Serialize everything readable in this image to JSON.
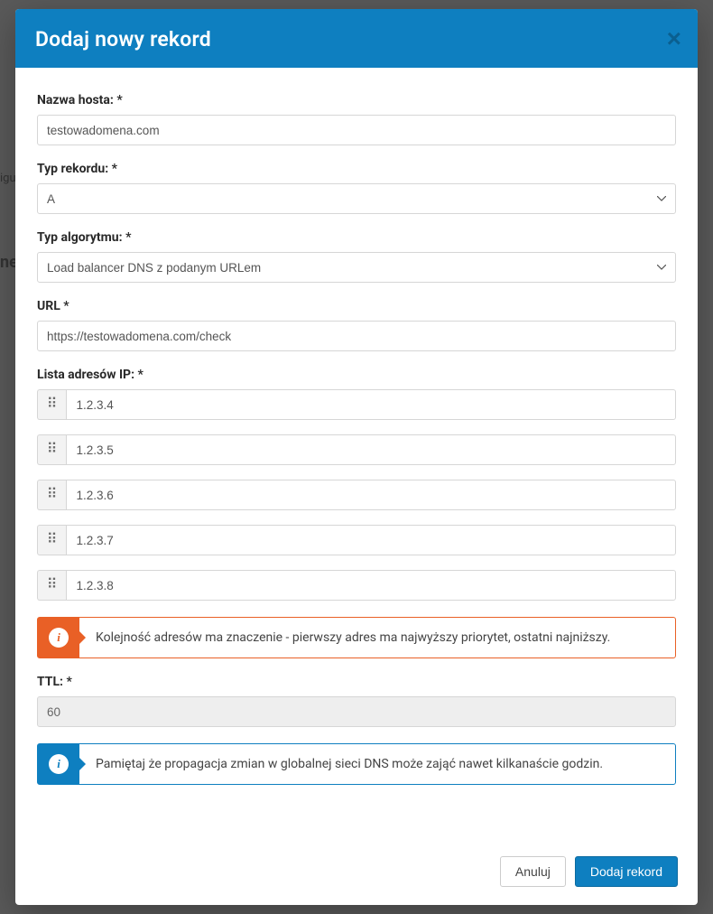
{
  "modal": {
    "title": "Dodaj nowy rekord",
    "close_label": "×"
  },
  "labels": {
    "hostname": "Nazwa hosta: *",
    "record_type": "Typ rekordu: *",
    "algorithm_type": "Typ algorytmu: *",
    "url": "URL *",
    "ip_list": "Lista adresów IP: *",
    "ttl": "TTL: *"
  },
  "values": {
    "hostname": "testowadomena.com",
    "record_type": "A",
    "algorithm_type": "Load balancer DNS z podanym URLem",
    "url": "https://testowadomena.com/check",
    "ttl": "60"
  },
  "ip_addresses": [
    "1.2.3.4",
    "1.2.3.5",
    "1.2.3.6",
    "1.2.3.7",
    "1.2.3.8"
  ],
  "alerts": {
    "order_info": "Kolejność adresów ma znaczenie - pierwszy adres ma najwyższy priorytet, ostatni najniższy.",
    "propagation_info": "Pamiętaj że propagacja zmian w globalnej sieci DNS może zająć nawet kilkanaście godzin."
  },
  "footer": {
    "cancel": "Anuluj",
    "submit": "Dodaj rekord"
  },
  "behind": {
    "b1": "igu",
    "b2": "ne"
  }
}
